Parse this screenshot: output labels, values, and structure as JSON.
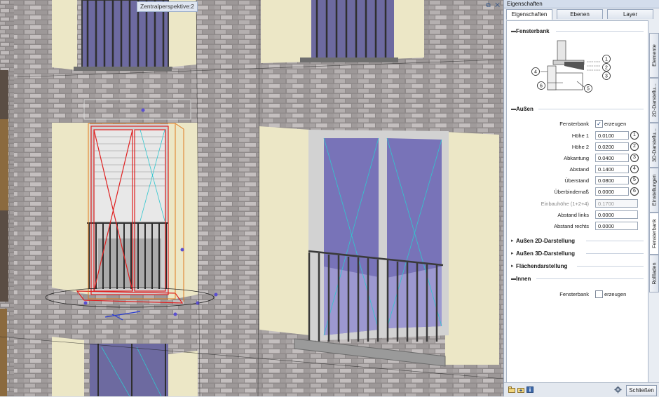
{
  "viewport": {
    "label": "Zentralperspektive:2",
    "controls": "⧉ ✕"
  },
  "panel": {
    "title": "Eigenschaften",
    "tabs": [
      "Eigenschaften",
      "Ebenen",
      "Layer"
    ],
    "side_tabs": [
      "Elemente",
      "2D-Darstellu...",
      "3D-Darstellu...",
      "Einstellungen",
      "Fensterbank",
      "Rollladen"
    ],
    "sections": {
      "fensterbank": "Fensterbank",
      "aussen": "Außen",
      "aussen_2d": "Außen 2D-Darstellung",
      "aussen_3d": "Außen 3D-Darstellung",
      "flaechen": "Flächendarstellung",
      "innen": "Innen"
    },
    "diagram_labels": [
      "1",
      "2",
      "3",
      "4",
      "5",
      "6"
    ],
    "aussen_rows": {
      "fensterbank": {
        "label": "Fensterbank",
        "checked": true,
        "text": "erzeugen"
      },
      "hoehe1": {
        "label": "Höhe 1",
        "value": "0.0100",
        "badge": "1"
      },
      "hoehe2": {
        "label": "Höhe 2",
        "value": "0.0200",
        "badge": "2"
      },
      "abkantung": {
        "label": "Abkantung",
        "value": "0.0400",
        "badge": "3"
      },
      "abstand": {
        "label": "Abstand",
        "value": "0.1400",
        "badge": "4"
      },
      "ueberstand": {
        "label": "Überstand",
        "value": "0.0800",
        "badge": "5"
      },
      "ueberbindemass": {
        "label": "Überbindemaß",
        "value": "0.0000",
        "badge": "6"
      },
      "einbauhoehe": {
        "label": "Einbauhöhe (1+2+4)",
        "value": "0.1700"
      },
      "abstand_links": {
        "label": "Abstand links",
        "value": "0.0000"
      },
      "abstand_rechts": {
        "label": "Abstand rechts",
        "value": "0.0000"
      }
    },
    "innen_rows": {
      "fensterbank": {
        "label": "Fensterbank",
        "checked": false,
        "text": "erzeugen"
      }
    },
    "bottom": {
      "close_label": "Schließen"
    }
  },
  "colors": {
    "accent": "#2a4f86",
    "brick": "#8a8585",
    "wall": "#ece7c6",
    "glass": "#7b78b4",
    "selection": "#e02020"
  }
}
